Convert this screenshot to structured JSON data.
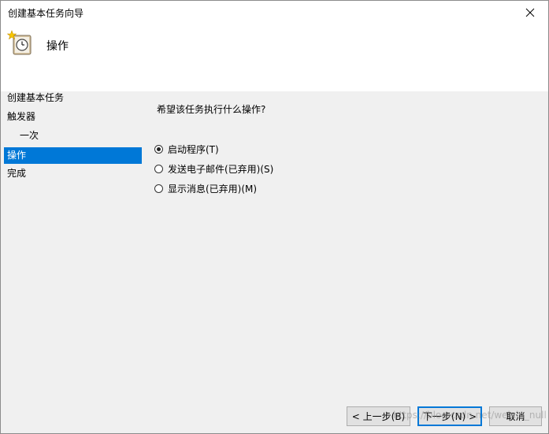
{
  "window": {
    "title": "创建基本任务向导"
  },
  "header": {
    "title": "操作",
    "icon": "task-scheduler-clock-icon"
  },
  "sidebar": {
    "items": [
      {
        "label": "创建基本任务"
      },
      {
        "label": "触发器"
      },
      {
        "label": "一次"
      },
      {
        "label": "操作"
      },
      {
        "label": "完成"
      }
    ],
    "selected": "操作"
  },
  "main": {
    "question": "希望该任务执行什么操作?",
    "options": [
      {
        "label": "启动程序(T)",
        "checked": true
      },
      {
        "label": "发送电子邮件(已弃用)(S)",
        "checked": false
      },
      {
        "label": "显示消息(已弃用)(M)",
        "checked": false
      }
    ]
  },
  "buttons": {
    "back": "< 上一步(B)",
    "next": "下一步(N) >",
    "cancel": "取消"
  },
  "watermark": "https://blog.csdn.net/weixin_null",
  "colors": {
    "selection": "#0078d7",
    "panel": "#f0f0f0",
    "header": "#ffffff"
  }
}
